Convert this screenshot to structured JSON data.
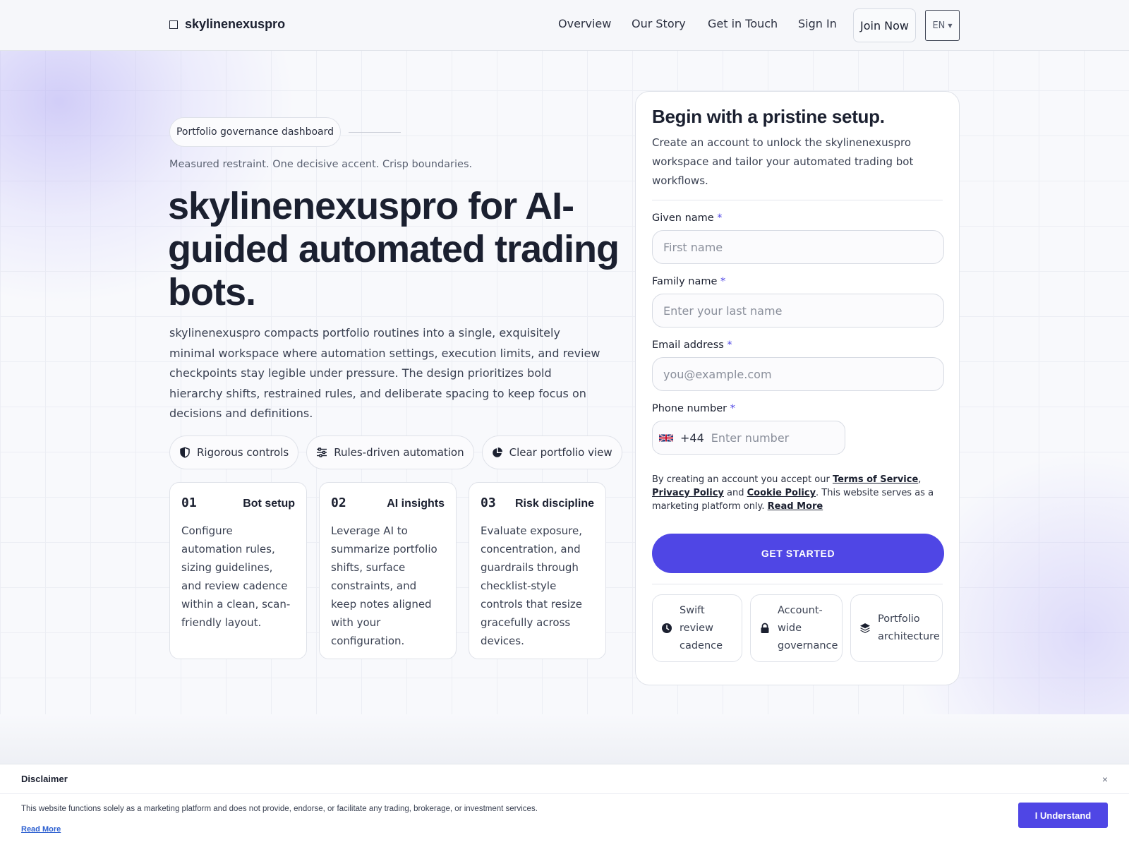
{
  "header": {
    "brand": "skylinenexuspro",
    "nav": [
      "Overview",
      "Our Story",
      "Get in Touch",
      "Sign In"
    ],
    "join": "Join Now",
    "lang": "EN"
  },
  "hero": {
    "pill": "Portfolio governance dashboard",
    "tagline": "Measured restraint. One decisive accent. Crisp boundaries.",
    "title": "skylinenexuspro for AI-guided automated trading bots.",
    "description": "skylinenexuspro compacts portfolio routines into a single, exquisitely minimal workspace where automation settings, execution limits, and review checkpoints stay legible under pressure. The design prioritizes bold hierarchy shifts, restrained rules, and deliberate spacing to keep focus on decisions and definitions.",
    "chips": [
      {
        "label": "Rigorous controls",
        "icon": "shield-icon"
      },
      {
        "label": "Rules-driven automation",
        "icon": "sliders-icon"
      },
      {
        "label": "Clear portfolio view",
        "icon": "pie-chart-icon"
      }
    ],
    "cards": [
      {
        "num": "01",
        "title": "Bot setup",
        "body": "Configure automation rules, sizing guidelines, and review cadence within a clean, scan-friendly layout."
      },
      {
        "num": "02",
        "title": "AI insights",
        "body": "Leverage AI to summarize portfolio shifts, surface constraints, and keep notes aligned with your configuration."
      },
      {
        "num": "03",
        "title": "Risk discipline",
        "body": "Evaluate exposure, concentration, and guardrails through checklist-style controls that resize gracefully across devices."
      }
    ]
  },
  "form": {
    "title": "Begin with a pristine setup.",
    "description": "Create an account to unlock the skylinenexuspro workspace and tailor your automated trading bot workflows.",
    "given_label": "Given name",
    "given_placeholder": "First name",
    "family_label": "Family name",
    "family_placeholder": "Enter your last name",
    "email_label": "Email address",
    "email_placeholder": "you@example.com",
    "phone_label": "Phone number",
    "dial_code": "+44",
    "phone_placeholder": "Enter number",
    "required_mark": "*",
    "consent_prefix": "By creating an account you accept our ",
    "terms": "Terms of Service",
    "comma": ", ",
    "privacy": "Privacy Policy",
    "and": " and ",
    "cookie": "Cookie Policy",
    "consent_suffix": ". This website serves as a marketing platform only. ",
    "read_more": "Read More",
    "cta": "GET STARTED",
    "features": [
      {
        "label": "Swift review cadence",
        "icon": "clock-icon"
      },
      {
        "label": "Account-wide governance",
        "icon": "lock-icon"
      },
      {
        "label": "Portfolio architecture",
        "icon": "layers-icon"
      }
    ]
  },
  "disclaimer": {
    "title": "Disclaimer",
    "close": "×",
    "text": "This website functions solely as a marketing platform and does not provide, endorse, or facilitate any trading, brokerage, or investment services.",
    "read_more": "Read More",
    "button": "I Understand"
  },
  "colors": {
    "accent": "#4f46e5",
    "text": "#1b2030"
  }
}
